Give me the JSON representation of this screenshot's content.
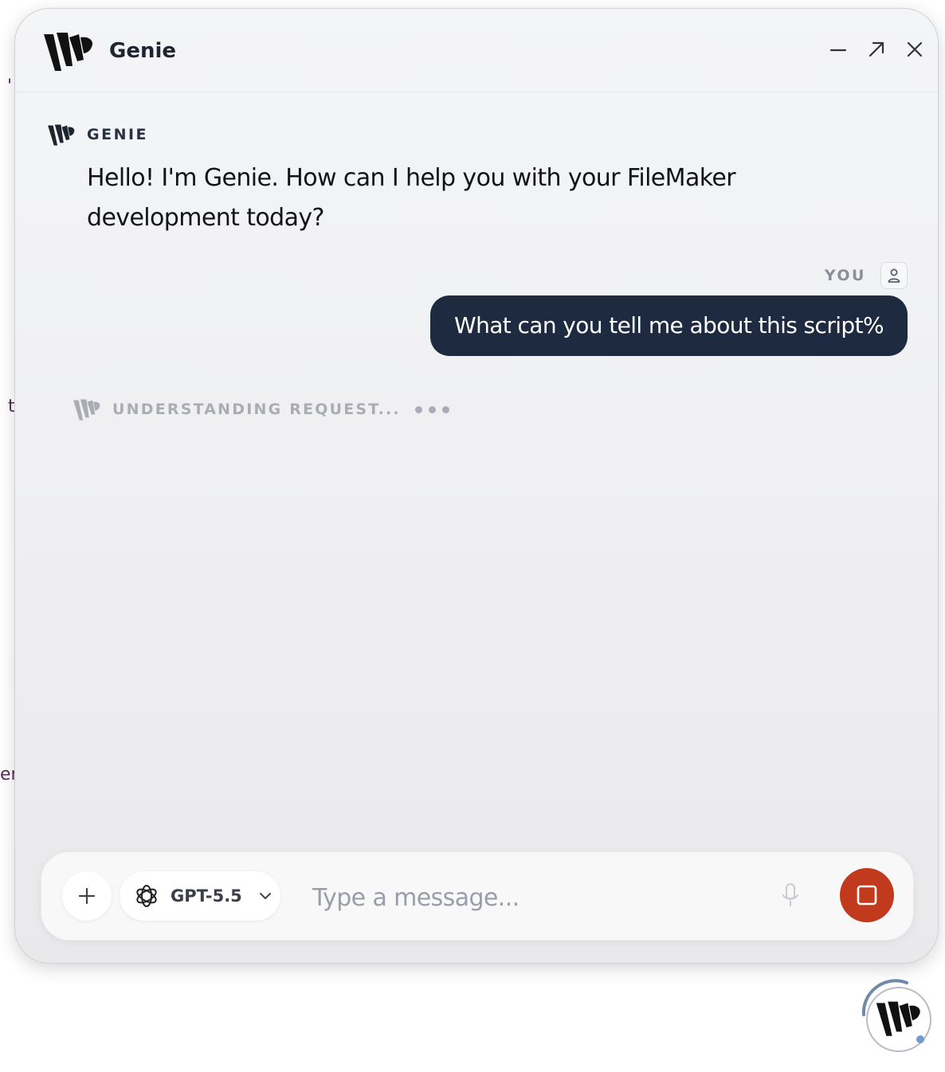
{
  "window": {
    "title": "Genie",
    "controls": {
      "minimize": "minimize-icon",
      "expand": "expand-arrow-icon",
      "close": "close-icon"
    }
  },
  "conversation": {
    "assistant_label": "GENIE",
    "assistant_message": "Hello! I'm Genie. How can I help you with your FileMaker development today?",
    "user_label": "YOU",
    "user_message": "What can you tell me about this script%",
    "status_text": "UNDERSTANDING REQUEST..."
  },
  "composer": {
    "attach_icon": "plus-icon",
    "model_label": "GPT-5.5",
    "model_icon": "openai-icon",
    "input_value": "",
    "input_placeholder": "Type a message...",
    "mic_icon": "microphone-icon",
    "stop_icon": "stop-icon"
  },
  "colors": {
    "user_bubble": "#1e2a40",
    "stop_button": "#c23a1d",
    "text_primary": "#111318"
  },
  "background_fragments": [
    "'",
    "t",
    "er"
  ]
}
